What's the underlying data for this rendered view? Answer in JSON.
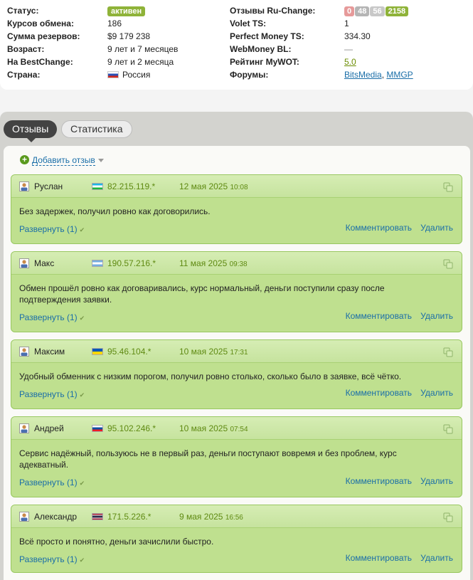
{
  "info": {
    "left": [
      {
        "label": "Статус:",
        "value": "активен",
        "type": "badge"
      },
      {
        "label": "Курсов обмена:",
        "value": "186"
      },
      {
        "label": "Сумма резервов:",
        "value": "$9 179 238"
      },
      {
        "label": "Возраст:",
        "value": "9 лет и 7 месяцев"
      },
      {
        "label": "На BestChange:",
        "value": "9 лет и 2 месяца"
      },
      {
        "label": "Страна:",
        "value": "Россия",
        "flag": "ru"
      }
    ],
    "right": {
      "reviews_label": "Отзывы Ru-Change:",
      "counts": [
        "0",
        "48",
        "56",
        "2158"
      ],
      "volet_label": "Volet TS:",
      "volet_value": "1",
      "pm_label": "Perfect Money TS:",
      "pm_value": "334.30",
      "wm_label": "WebMoney BL:",
      "wm_value": "—",
      "mywot_label": "Рейтинг MyWOT:",
      "mywot_value": "5.0",
      "forums_label": "Форумы:",
      "forum_1": "BitsMedia",
      "forum_sep": ", ",
      "forum_2": "MMGP"
    }
  },
  "tabs": {
    "reviews": "Отзывы",
    "stats": "Статистика"
  },
  "add_review": "Добавить отзыв",
  "actions": {
    "expand": "Развернуть (1)",
    "comment": "Комментировать",
    "delete": "Удалить"
  },
  "reviews": [
    {
      "name": "Руслан",
      "flag": "uz",
      "ip": "82.215.119.*",
      "date": "12 мая 2025",
      "time": "10:08",
      "text": [
        "Без задержек, получил ровно как договорились."
      ]
    },
    {
      "name": "Макс",
      "flag": "ar",
      "ip": "190.57.216.*",
      "date": "11 мая 2025",
      "time": "09:38",
      "text": [
        "Обмен прошёл ровно как договаривались, курс нормальный, деньги поступили сразу после",
        "подтверждения заявки."
      ]
    },
    {
      "name": "Максим",
      "flag": "ua",
      "ip": "95.46.104.*",
      "date": "10 мая 2025",
      "time": "17:31",
      "text": [
        "Удобный обменник с низким порогом, получил ровно столько, сколько было в заявке, всё чётко."
      ]
    },
    {
      "name": "Андрей",
      "flag": "sk",
      "ip": "95.102.246.*",
      "date": "10 мая 2025",
      "time": "07:54",
      "text": [
        "Сервис надёжный, пользуюсь не в первый раз, деньги поступают вовремя и без проблем, курс",
        "адекватный."
      ]
    },
    {
      "name": "Александр",
      "flag": "th",
      "ip": "171.5.226.*",
      "date": "9 мая 2025",
      "time": "16:56",
      "text": [
        "Всё просто и понятно, деньги зачислили быстро."
      ]
    }
  ]
}
